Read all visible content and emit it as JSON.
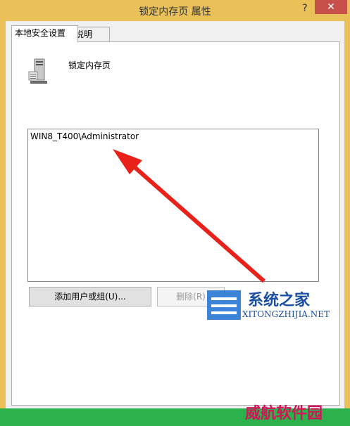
{
  "window": {
    "title": "锁定内存页 属性",
    "help_label": "?",
    "close_label": "✕"
  },
  "tabs": [
    {
      "label": "本地安全设置"
    },
    {
      "label": "说明"
    }
  ],
  "policy": {
    "name": "锁定内存页",
    "icon": "computer-tower-icon"
  },
  "list": {
    "items": [
      "WIN8_T400\\Administrator"
    ]
  },
  "buttons": {
    "add_label": "添加用户或组(U)...",
    "remove_label": "删除(R)"
  },
  "watermarks": {
    "site_main": "系统之家",
    "site_sub": "XITONGZHIJIA.NET",
    "site2": "威航软件园"
  },
  "colors": {
    "titlebar": "#e9c158",
    "close": "#c7504b",
    "arrow": "#e8221b",
    "green_bar": "#2bb24c"
  }
}
